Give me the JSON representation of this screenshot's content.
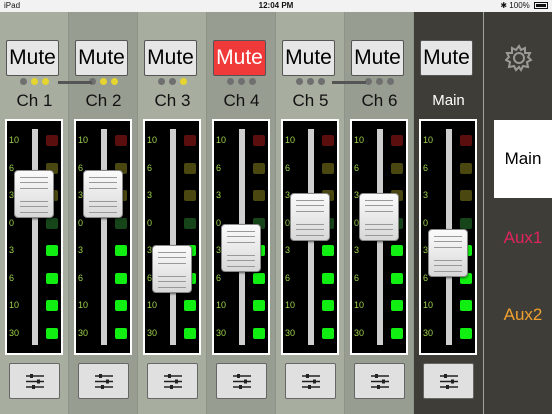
{
  "status_bar": {
    "device": "iPad",
    "time": "12:04 PM",
    "battery": "100%"
  },
  "strips": [
    {
      "id": "ch1",
      "name": "Ch 1",
      "mute_label": "Mute",
      "muted": false,
      "dots": [
        "off",
        "yellow",
        "yellow"
      ],
      "fader": 0.74
    },
    {
      "id": "ch2",
      "name": "Ch 2",
      "mute_label": "Mute",
      "muted": false,
      "dots": [
        "off",
        "yellow",
        "yellow"
      ],
      "fader": 0.74
    },
    {
      "id": "ch3",
      "name": "Ch 3",
      "mute_label": "Mute",
      "muted": false,
      "dots": [
        "off",
        "off",
        "yellow"
      ],
      "fader": 0.31
    },
    {
      "id": "ch4",
      "name": "Ch 4",
      "mute_label": "Mute",
      "muted": true,
      "dots": [
        "off",
        "off",
        "off"
      ],
      "fader": 0.43
    },
    {
      "id": "ch5",
      "name": "Ch 5",
      "mute_label": "Mute",
      "muted": false,
      "dots": [
        "off",
        "off",
        "off"
      ],
      "fader": 0.61
    },
    {
      "id": "ch6",
      "name": "Ch 6",
      "mute_label": "Mute",
      "muted": false,
      "dots": [
        "off",
        "off",
        "off"
      ],
      "fader": 0.61
    },
    {
      "id": "main",
      "name": "Main",
      "mute_label": "Mute",
      "muted": false,
      "dots": [],
      "fader": 0.4
    }
  ],
  "scale_labels": [
    "10",
    "6",
    "3",
    "0",
    "3",
    "6",
    "10",
    "30"
  ],
  "side_tabs": [
    {
      "label": "Main",
      "color": "#000000",
      "selected": true
    },
    {
      "label": "Aux1",
      "color": "#e0245e",
      "selected": false
    },
    {
      "label": "Aux2",
      "color": "#f0a030",
      "selected": false
    }
  ],
  "colors": {
    "mute_active": "#f03a3a",
    "meter_green": "#11ee11",
    "scale_text": "#9fd34a"
  },
  "icons": {
    "settings": "gear-icon",
    "eq": "sliders-icon"
  }
}
